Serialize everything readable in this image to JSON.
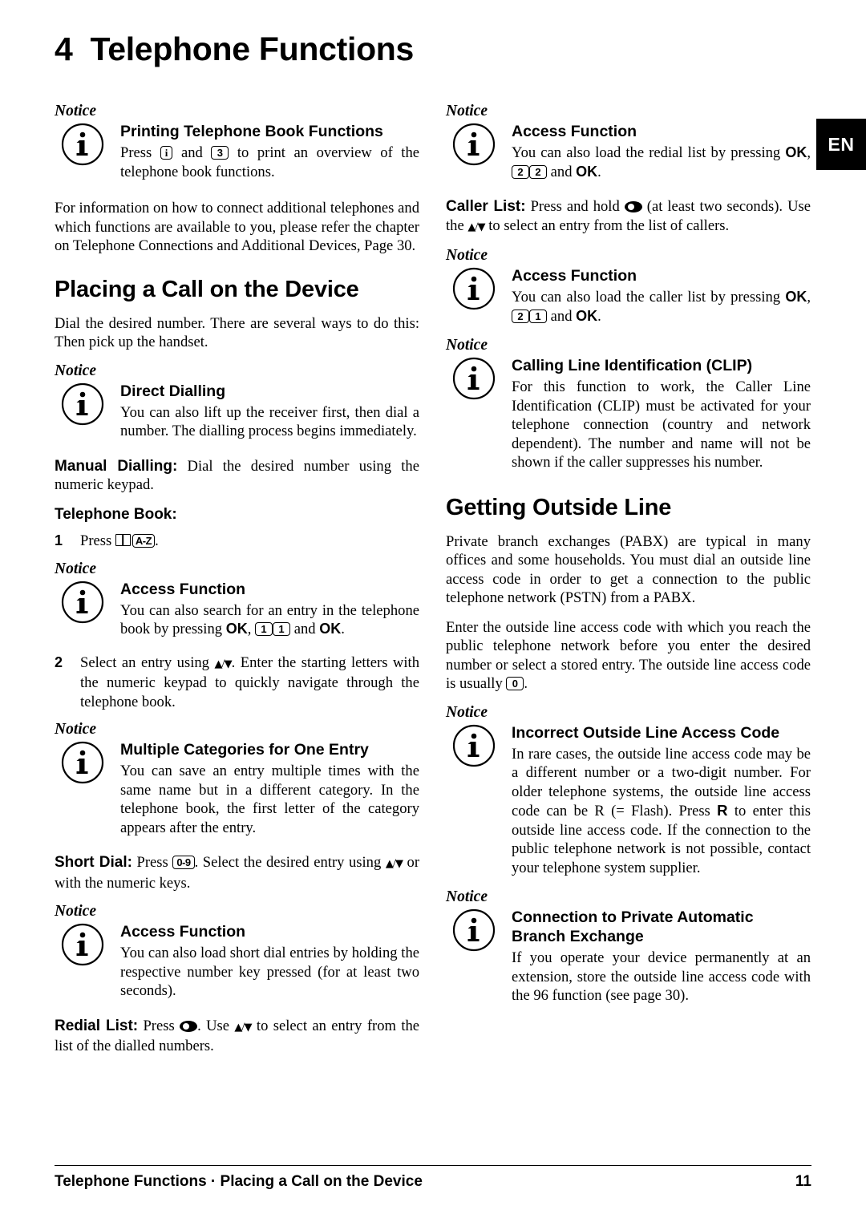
{
  "chapter": {
    "number": "4",
    "title": "Telephone Functions"
  },
  "lang_tab": "EN",
  "notice_label": "Notice",
  "left": {
    "notice_printing": {
      "title": "Printing Telephone Book Functions",
      "text_before": "Press",
      "key1": "i",
      "text_mid": "and",
      "key2": "3",
      "text_after": "to print an overview of the telephone book functions."
    },
    "para_connect": "For information on how to connect additional telephones and which functions are available to you, please refer the chapter on Telephone Connections and Additional Devices, Page 30.",
    "section_placing": "Placing a Call on the Device",
    "para_dial": "Dial the desired number. There are several ways to do this: Then pick up the handset.",
    "notice_direct": {
      "title": "Direct Dialling",
      "text": "You can also lift up the receiver first, then dial a number. The dialling process begins immediately."
    },
    "manual_dialling_lead": "Manual Dialling:",
    "manual_dialling_text": "Dial the desired number using the numeric keypad.",
    "telephone_book_lead": "Telephone Book:",
    "step1_num": "1",
    "step1_text_before": "Press",
    "step1_key": "A-Z",
    "step1_text_after": ".",
    "notice_access1": {
      "title": "Access Function",
      "text_before": "You can also search for an entry in the telephone book by pressing",
      "ok1": "OK",
      "comma": ",",
      "key1": "1",
      "key2": "1",
      "text_mid": "and",
      "ok2": "OK",
      "text_after": "."
    },
    "step2_num": "2",
    "step2_text_before": "Select an entry using",
    "step2_text_after": ". Enter the starting letters with the numeric keypad to quickly navigate through the telephone book.",
    "notice_multiple": {
      "title": "Multiple Categories for One Entry",
      "text": "You can save an entry multiple times with the same name but in a different category. In the telephone book, the first letter of the category appears after the entry."
    },
    "short_dial_lead": "Short Dial:",
    "short_dial_before": "Press",
    "short_dial_key": "0-9",
    "short_dial_mid": ". Select the desired entry using",
    "short_dial_after": "or with the numeric keys.",
    "notice_access2": {
      "title": "Access Function",
      "text": "You can also load short dial entries by holding the respective number key pressed (for at least two seconds)."
    },
    "redial_lead": "Redial List:",
    "redial_before": "Press",
    "redial_mid": ". Use",
    "redial_after": "to select an entry from the list of the dialled numbers."
  },
  "right": {
    "notice_access_redial": {
      "title": "Access Function",
      "text_before": "You can also load the redial list by pressing",
      "ok1": "OK",
      "comma": ",",
      "key1": "2",
      "key2": "2",
      "text_mid": "and",
      "ok2": "OK",
      "text_after": "."
    },
    "caller_list_lead": "Caller List:",
    "caller_list_before": "Press and hold",
    "caller_list_after": "(at least two seconds). Use the",
    "caller_list_end": "to select an entry from the list of callers.",
    "notice_access_caller": {
      "title": "Access Function",
      "text_before": "You can also load the caller list by pressing",
      "ok1": "OK",
      "comma": ",",
      "key1": "2",
      "key2": "1",
      "text_mid": "and",
      "ok2": "OK",
      "text_after": "."
    },
    "notice_clip": {
      "title": "Calling Line Identification (CLIP)",
      "text": "For this function to work, the Caller Line Identification (CLIP) must be activated for your telephone connection (country and network dependent). The number and name will not be shown if the caller suppresses his number."
    },
    "section_outside": "Getting Outside Line",
    "para_pabx": "Private branch exchanges (PABX) are typical in many offices and some households. You must dial an outside line access code in order to get a connection to the public telephone network (PSTN) from a PABX.",
    "para_enter_before": "Enter the outside line access code with which you reach the public telephone network before you enter the desired number or select a stored entry. The outside line access code is usually",
    "para_enter_key": "0",
    "para_enter_after": ".",
    "notice_incorrect": {
      "title": "Incorrect Outside Line Access Code",
      "text_before": "In rare cases, the outside line access code may be a different number or a two-digit number. For older telephone systems, the outside line access code can be R (= Flash). Press",
      "key_r": "R",
      "text_after": "to enter this outside line access code. If the connection to the public telephone network is not possible, contact your telephone system supplier."
    },
    "notice_pabx": {
      "title_line1": "Connection to Private Automatic",
      "title_line2": "Branch Exchange",
      "text": "If you operate your device permanently at an extension, store the outside line access code with the 96 function (see page 30)."
    }
  },
  "footer": {
    "left": "Telephone Functions · Placing a Call on the Device",
    "page": "11"
  }
}
